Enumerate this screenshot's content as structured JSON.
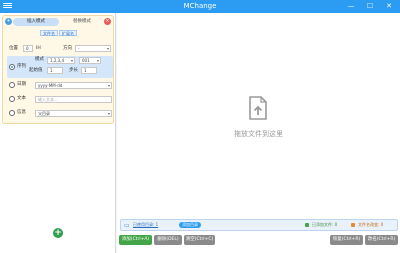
{
  "window": {
    "title": "MChange"
  },
  "titlebar": {
    "minimize": "—",
    "maximize": "☐",
    "close": "✕"
  },
  "panel": {
    "tabs": [
      "插入模式",
      "替换模式"
    ],
    "text_buttons": [
      "文件名",
      "扩展名"
    ],
    "position": {
      "label": "位置",
      "value": "0",
      "unit": "IH",
      "direction_label": "方向",
      "direction_value": "-"
    },
    "sequence": {
      "label": "序列",
      "mode_label": "模式",
      "mode_value": "1,2,3,4",
      "format_value": "001",
      "start_label": "起始值",
      "start_value": "1",
      "step_label": "步长",
      "step_value": "1"
    },
    "date": {
      "label": "日期",
      "value": "yyyy-MM-dd"
    },
    "text": {
      "label": "文本",
      "placeholder": "输入文本..."
    },
    "info": {
      "label": "信息",
      "value": "父目录"
    }
  },
  "main": {
    "drop_hint": "拖放文件到这里",
    "status": {
      "path_label": "已使用目录: 1",
      "pill_label": "添加目录",
      "done_label": "已添加文件: 0",
      "changed_label": "文件名改变: 0"
    }
  },
  "bottom": {
    "add_label": "添加(Ctrl+A)",
    "delete_label": "删除(DEL)",
    "clear_label": "清空(Ctrl+C)",
    "restore_label": "恢复(Ctrl+R)",
    "rename_label": "改名(Ctrl+R)"
  },
  "colors": {
    "titlebar": "#2b9cf2",
    "add_button": "#43a547",
    "delete_button": "#8a8a8a",
    "clear_button": "#8a8a8a",
    "restore_button": "#8a8a8a",
    "rename_button": "#8a8a8a",
    "panel_bg": "#fff8e6"
  }
}
